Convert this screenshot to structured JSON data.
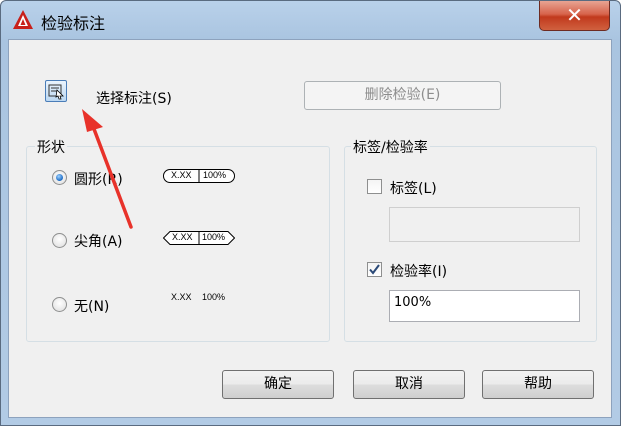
{
  "window": {
    "title": "检验标注",
    "close_symbol": "✕"
  },
  "top": {
    "select_label": "选择标注(S)",
    "delete_button": "删除检验(E)"
  },
  "shape_group": {
    "title": "形状",
    "options": [
      {
        "label": "圆形(R)",
        "selected": true,
        "sample_left": "X.XX",
        "sample_right": "100%"
      },
      {
        "label": "尖角(A)",
        "selected": false,
        "sample_left": "X.XX",
        "sample_right": "100%"
      },
      {
        "label": "无(N)",
        "selected": false,
        "sample_left": "X.XX",
        "sample_right": "100%"
      }
    ]
  },
  "label_group": {
    "title": "标签/检验率",
    "label_checkbox": {
      "label": "标签(L)",
      "checked": false,
      "value": ""
    },
    "rate_checkbox": {
      "label": "检验率(I)",
      "checked": true,
      "value": "100%"
    }
  },
  "buttons": {
    "ok": "确定",
    "cancel": "取消",
    "help": "帮助"
  },
  "colors": {
    "accent": "#1a6ac4",
    "close": "#c1391d",
    "annotation_arrow": "#e8322a"
  }
}
